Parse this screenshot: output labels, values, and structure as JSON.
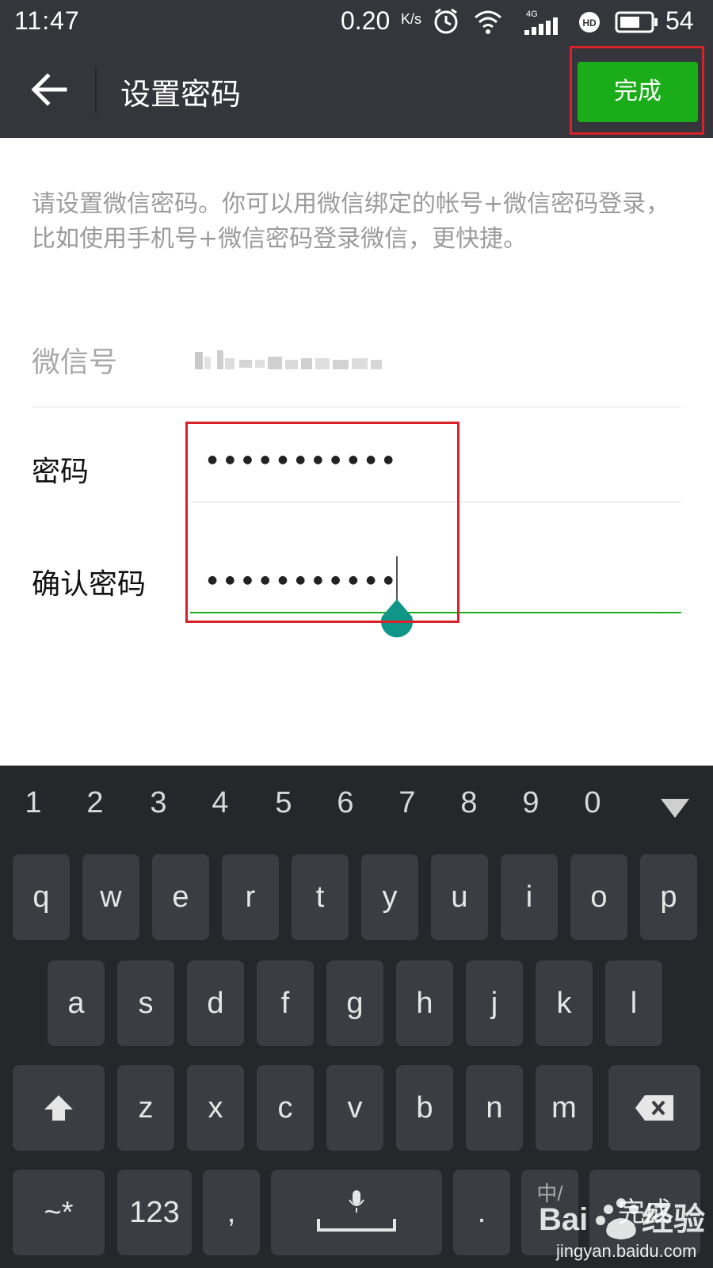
{
  "status_bar": {
    "time": "11:47",
    "net_speed": "0.20",
    "net_unit": "K/s",
    "network": "4G",
    "battery": "54",
    "icons": [
      "alarm-icon",
      "wifi-icon",
      "signal-icon",
      "hd-icon",
      "battery-icon"
    ]
  },
  "header": {
    "title": "设置密码",
    "done_label": "完成"
  },
  "description": "请设置微信密码。你可以用微信绑定的帐号+微信密码登录，比如使用手机号+微信密码登录微信，更快捷。",
  "form": {
    "account_label": "微信号",
    "password_label": "密码",
    "password_value": "●●●●●●●●●●●",
    "confirm_label": "确认密码",
    "confirm_value": "●●●●●●●●●●●"
  },
  "keyboard": {
    "numbers": [
      "1",
      "2",
      "3",
      "4",
      "5",
      "6",
      "7",
      "8",
      "9",
      "0"
    ],
    "row1": [
      "q",
      "w",
      "e",
      "r",
      "t",
      "y",
      "u",
      "i",
      "o",
      "p"
    ],
    "row2": [
      "a",
      "s",
      "d",
      "f",
      "g",
      "h",
      "j",
      "k",
      "l"
    ],
    "row3": [
      "z",
      "x",
      "c",
      "v",
      "b",
      "n",
      "m"
    ],
    "symbols_label": "~*",
    "numeric_label": "123",
    "comma_label": ",",
    "period_label": ".",
    "lang_label": "中/",
    "action_label": "完成"
  },
  "watermark": {
    "text": "jingyan.baidu.com"
  },
  "colors": {
    "bar_bg": "#35363b",
    "accent_green": "#1aad19",
    "highlight_red": "#d8222b",
    "keyboard_bg": "#26272b",
    "key_bg": "#3b3d42"
  }
}
